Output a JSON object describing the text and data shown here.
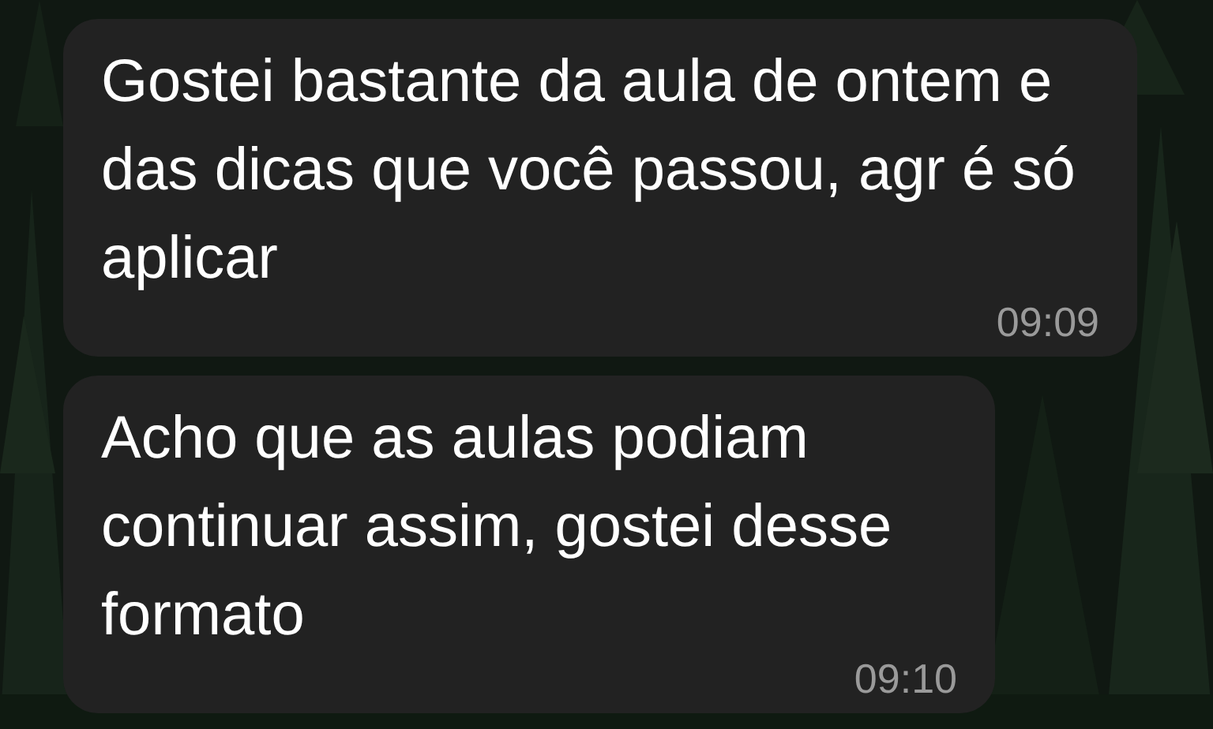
{
  "messages": [
    {
      "text": "Gostei bastante da aula de ontem e das dicas que você passou, agr é só aplicar",
      "time": "09:09"
    },
    {
      "text": "Acho que as aulas podiam continuar assim, gostei desse formato",
      "time": "09:10"
    }
  ]
}
